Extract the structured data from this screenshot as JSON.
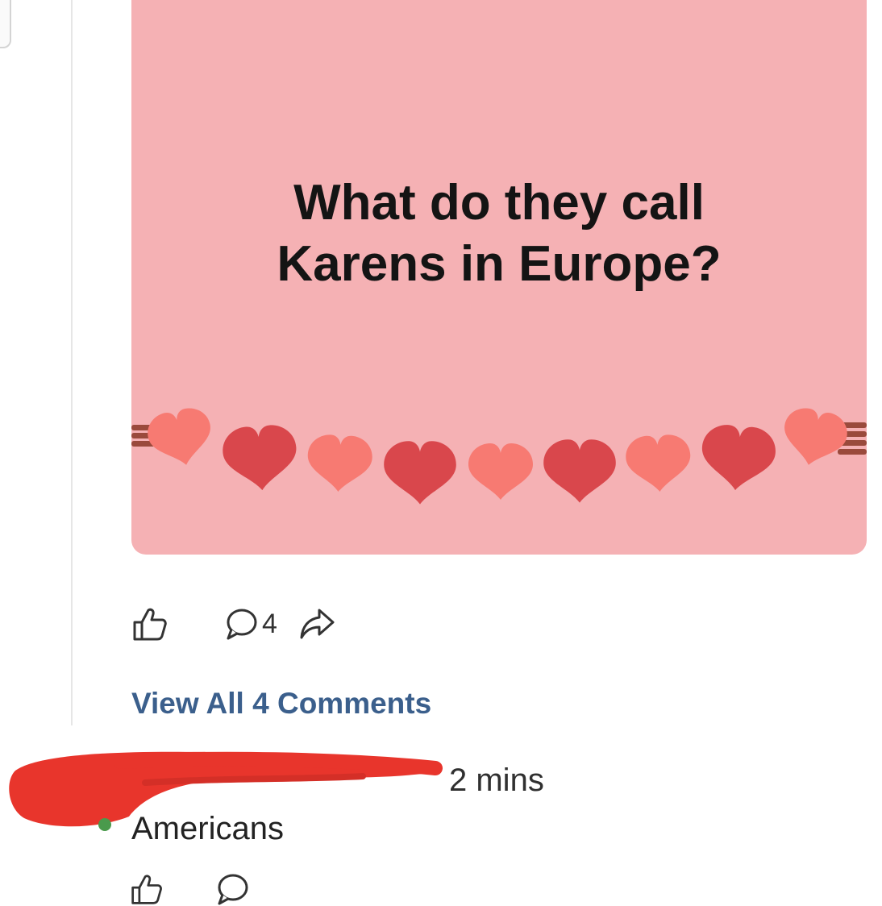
{
  "post": {
    "image_text_line1": "What do they call",
    "image_text_line2": "Karens in Europe?",
    "comment_count": "4"
  },
  "comments_link": "View All 4 Comments",
  "comment": {
    "time": "2 mins",
    "text": "Americans"
  },
  "icons": {
    "like": "thumbs-up-icon",
    "comment": "comment-bubble-icon",
    "share": "share-arrow-icon"
  },
  "colors": {
    "image_background": "#f5b1b4",
    "link": "#3b5f8c",
    "redaction": "#e8352c"
  }
}
